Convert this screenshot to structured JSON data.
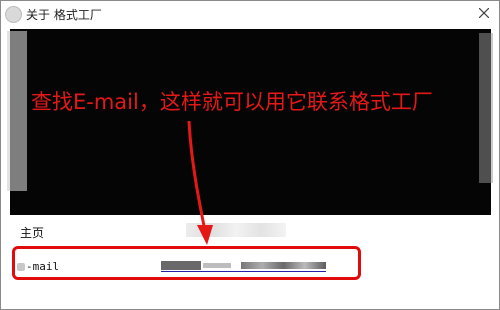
{
  "window": {
    "title": "关于 格式工厂",
    "close_icon": "close-icon"
  },
  "banner": {
    "caption": "查找E-mail，这样就可以用它联系格式工厂"
  },
  "fields": {
    "homepage_label": "主页",
    "email_label": "-mail"
  },
  "colors": {
    "annotation": "#e51818",
    "highlight_box": "#e10b0b",
    "banner_bg": "#050505"
  }
}
